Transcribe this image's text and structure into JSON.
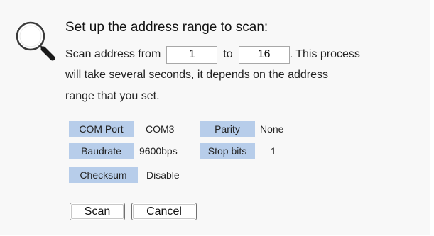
{
  "icons": {
    "search": "search-icon"
  },
  "dialog": {
    "title": "Set up the address range to scan:",
    "scan_from_text": "Scan address from",
    "to_text": "to",
    "from_value": "1",
    "to_value": "16",
    "process_text": ". This process",
    "line2": "will take several seconds, it depends on the address",
    "line3": "range that you set."
  },
  "settings": {
    "com_port_label": "COM Port",
    "com_port_value": "COM3",
    "parity_label": "Parity",
    "parity_value": "None",
    "baudrate_label": "Baudrate",
    "baudrate_value": "9600bps",
    "stop_bits_label": "Stop bits",
    "stop_bits_value": "1",
    "checksum_label": "Checksum",
    "checksum_value": "Disable"
  },
  "buttons": {
    "scan": "Scan",
    "cancel": "Cancel"
  },
  "colors": {
    "label_background": "#b7cdea",
    "panel_background": "#f8f8f8"
  }
}
